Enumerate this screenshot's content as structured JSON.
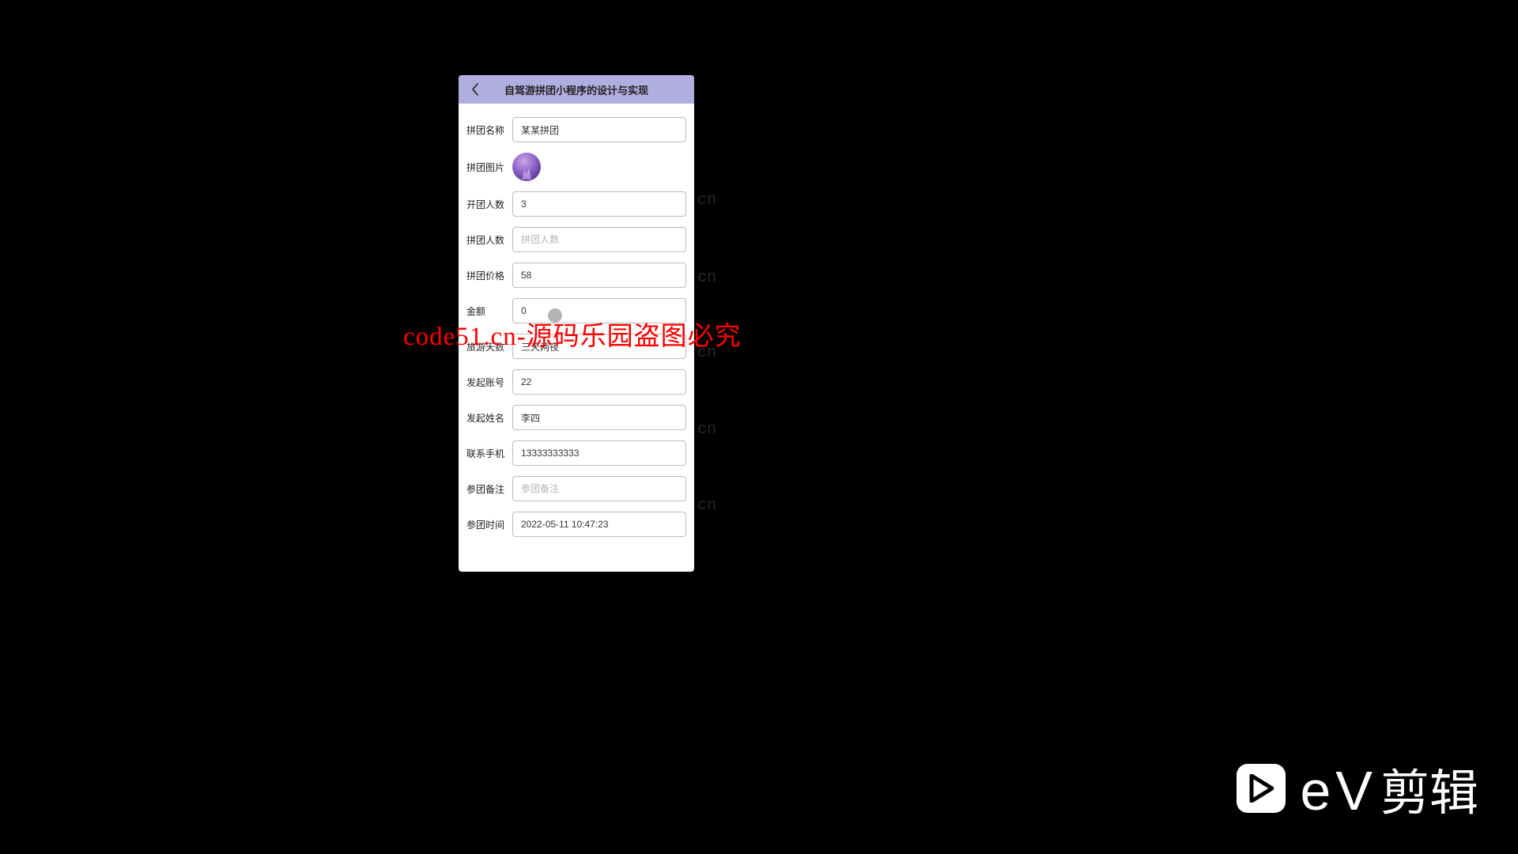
{
  "header": {
    "title": "自驾游拼团小程序的设计与实现"
  },
  "form": {
    "group_name": {
      "label": "拼团名称",
      "value": "某某拼团"
    },
    "group_image": {
      "label": "拼团图片"
    },
    "open_count": {
      "label": "开团人数",
      "value": "3"
    },
    "group_count": {
      "label": "拼团人数",
      "value": "",
      "placeholder": "拼团人数"
    },
    "group_price": {
      "label": "拼团价格",
      "value": "58"
    },
    "amount": {
      "label": "金额",
      "value": "0"
    },
    "travel_days": {
      "label": "旅游天数",
      "value": "三天两夜"
    },
    "initiator_acct": {
      "label": "发起账号",
      "value": "22"
    },
    "initiator_name": {
      "label": "发起姓名",
      "value": "李四"
    },
    "phone": {
      "label": "联系手机",
      "value": "13333333333"
    },
    "remark": {
      "label": "参团备注",
      "value": "",
      "placeholder": "参团备注"
    },
    "join_time": {
      "label": "参团时间",
      "value": "2022-05-11 10:47:23"
    }
  },
  "watermark_text": "code51.cn",
  "overlay_text": "code51.cn-源码乐园盗图必究",
  "ev_logo": {
    "e": "e",
    "v": "V",
    "cn": "剪辑"
  }
}
